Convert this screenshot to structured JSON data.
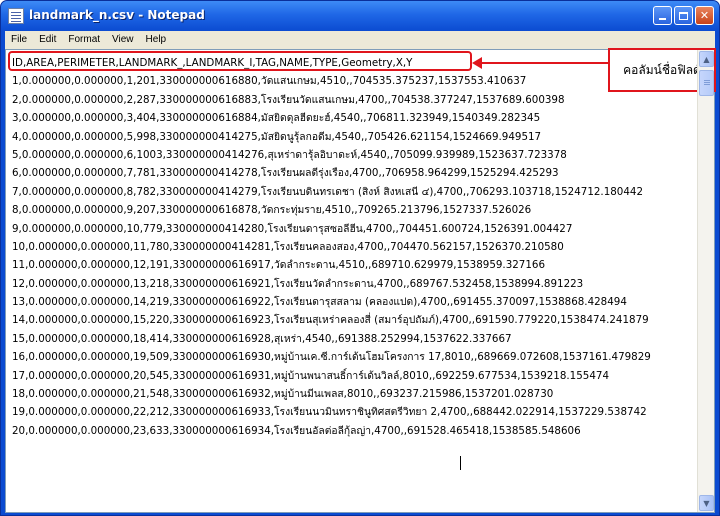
{
  "window": {
    "title": "landmark_n.csv - Notepad"
  },
  "menubar": {
    "items": [
      "File",
      "Edit",
      "Format",
      "View",
      "Help"
    ]
  },
  "editor": {
    "lines": [
      "ID,AREA,PERIMETER,LANDMARK_,LANDMARK_I,TAG,NAME,TYPE,Geometry,X,Y",
      "1,0.000000,0.000000,1,201,330000000616880,วัดแสนเกษม,4510,,704535.375237,1537553.410637",
      "2,0.000000,0.000000,2,287,330000000616883,โรงเรียนวัดแสนเกษม,4700,,704538.377247,1537689.600398",
      "3,0.000000,0.000000,3,404,330000000616884,มัสยิดดุลฮีดยะฮ์,4540,,706811.323949,1540349.282345",
      "4,0.000000,0.000000,5,998,330000000414275,มัสยิดนูรุ้ลกอดีม,4540,,705426.621154,1524669.949517",
      "5,0.000000,0.000000,6,1003,330000000414276,สุเหร่าดารุ้ลอิบาดะห์,4540,,705099.939989,1523637.723378",
      "6,0.000000,0.000000,7,781,330000000414278,โรงเรียนผลดีรุ่งเรือง,4700,,706958.964299,1525294.425293",
      "7,0.000000,0.000000,8,782,330000000414279,โรงเรียนบดินทรเดชา (สิงห์ สิงหเสนี ๔),4700,,706293.103718,1524712.180442",
      "8,0.000000,0.000000,9,207,330000000616878,วัดกระทุ่มราย,4510,,709265.213796,1527337.526026",
      "9,0.000000,0.000000,10,779,330000000414280,โรงเรียนดารุสซอลีฮีน,4700,,704451.600724,1526391.004427",
      "10,0.000000,0.000000,11,780,330000000414281,โรงเรียนคลองสอง,4700,,704470.562157,1526370.210580",
      "11,0.000000,0.000000,12,191,330000000616917,วัดลำกระดาน,4510,,689710.629979,1538959.327166",
      "12,0.000000,0.000000,13,218,330000000616921,โรงเรียนวัดลำกระดาน,4700,,689767.532458,1538994.891223",
      "13,0.000000,0.000000,14,219,330000000616922,โรงเรียนดารุสสลาม (คลองแปด),4700,,691455.370097,1538868.428494",
      "14,0.000000,0.000000,15,220,330000000616923,โรงเรียนสุเหร่าคลองสี่ (สมาร์อุปถัมภ์),4700,,691590.779220,1538474.241879",
      "15,0.000000,0.000000,18,414,330000000616928,สุเหร่า,4540,,691388.252994,1537622.337667",
      "16,0.000000,0.000000,19,509,330000000616930,หมู่บ้านเค.ซี.การ์เด้นโฮมโครงการ 17,8010,,689669.072608,1537161.479829",
      "17,0.000000,0.000000,20,545,330000000616931,หมู่บ้านพนาสนธิ์การ์เด้นวิลล์,8010,,692259.677534,1539218.155474",
      "18,0.000000,0.000000,21,548,330000000616932,หมู่บ้านมีนเพลส,8010,,693237.215986,1537201.028730",
      "19,0.000000,0.000000,22,212,330000000616933,โรงเรียนนวมินทราชินูทิศสตรีวิทยา 2,4700,,688442.022914,1537229.538742",
      "20,0.000000,0.000000,23,633,330000000616934,โรงเรียนอัลต่อลีกุ้ลญ่า,4700,,691528.465418,1538585.548606"
    ]
  },
  "annotation": {
    "label": "คอลัมน์ชื่อฟิลด์",
    "color": "#e0151c"
  },
  "icons": {
    "app": "notepad-icon",
    "minimize": "minimize-icon",
    "maximize": "maximize-icon",
    "close": "close-icon"
  }
}
